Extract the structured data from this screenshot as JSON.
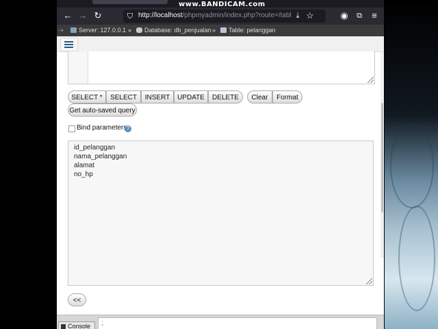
{
  "watermark": "www.BANDICAM.com",
  "browser": {
    "url_host": "http://localhost",
    "url_path": "/phpmyadmin/index.php?route=/tabl",
    "icons": [
      "back-arrow-icon",
      "forward-arrow-icon",
      "reload-icon",
      "shield-icon",
      "download-icon",
      "star-icon",
      "account-icon",
      "extensions-icon",
      "menu-icon"
    ]
  },
  "breadcrumb": {
    "server": "Server: 127.0.0.1",
    "database": "Database: db_penjualan",
    "table": "Table: pelanggan",
    "separator": "»"
  },
  "toolbar": {
    "buttons": [
      "SELECT *",
      "SELECT",
      "INSERT",
      "UPDATE",
      "DELETE"
    ],
    "clear": "Clear",
    "format": "Format",
    "autosaved": "Get auto-saved query"
  },
  "bind_parameters": {
    "label": "Bind parameters",
    "checked": false,
    "help": "?"
  },
  "columns": [
    "id_pelanggan",
    "nama_pelanggan",
    "alamat",
    "no_hp"
  ],
  "insert_button": "<<",
  "console": {
    "button": "Console",
    "input_value": ";"
  },
  "colors": {
    "nav_bg": "#2b2a33",
    "breadcrumb_bg": "#3b3b3b",
    "accent": "#235a81"
  }
}
